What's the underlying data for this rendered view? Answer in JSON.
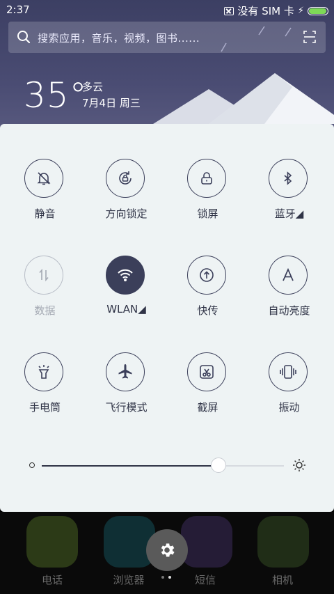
{
  "status_bar": {
    "time": "2:37",
    "carrier": "没有 SIM 卡",
    "battery_level": 0.95
  },
  "search": {
    "placeholder": "搜索应用，音乐，视频，图书......"
  },
  "weather": {
    "temperature": "35°",
    "condition": "多云",
    "date": "7月4日 周三"
  },
  "quick_settings": {
    "tiles": [
      {
        "label": "静音",
        "icon": "bell-off-icon",
        "state": "off"
      },
      {
        "label": "方向锁定",
        "icon": "rotation-lock-icon",
        "state": "off"
      },
      {
        "label": "锁屏",
        "icon": "lock-icon",
        "state": "off"
      },
      {
        "label": "蓝牙◢",
        "icon": "bluetooth-icon",
        "state": "off"
      },
      {
        "label": "数据",
        "icon": "mobile-data-icon",
        "state": "disabled"
      },
      {
        "label": "WLAN◢",
        "icon": "wifi-icon",
        "state": "on"
      },
      {
        "label": "快传",
        "icon": "quick-share-icon",
        "state": "off"
      },
      {
        "label": "自动亮度",
        "icon": "auto-brightness-icon",
        "state": "off"
      },
      {
        "label": "手电筒",
        "icon": "flashlight-icon",
        "state": "off"
      },
      {
        "label": "飞行模式",
        "icon": "airplane-icon",
        "state": "off"
      },
      {
        "label": "截屏",
        "icon": "screenshot-icon",
        "state": "off"
      },
      {
        "label": "振动",
        "icon": "vibrate-icon",
        "state": "off"
      }
    ],
    "brightness_level": 0.73
  },
  "dock": {
    "apps": [
      {
        "label": "电话",
        "icon": "phone-app-icon"
      },
      {
        "label": "浏览器",
        "icon": "browser-app-icon"
      },
      {
        "label": "短信",
        "icon": "messages-app-icon"
      },
      {
        "label": "相机",
        "icon": "camera-app-icon"
      }
    ],
    "settings_icon": "gear-icon",
    "pages": 2,
    "current_page": 2
  },
  "colors": {
    "accent": "#3b3f5a",
    "panel_bg": "#eef3f4",
    "wallpaper": "#42456b",
    "battery": "#7ed957"
  }
}
